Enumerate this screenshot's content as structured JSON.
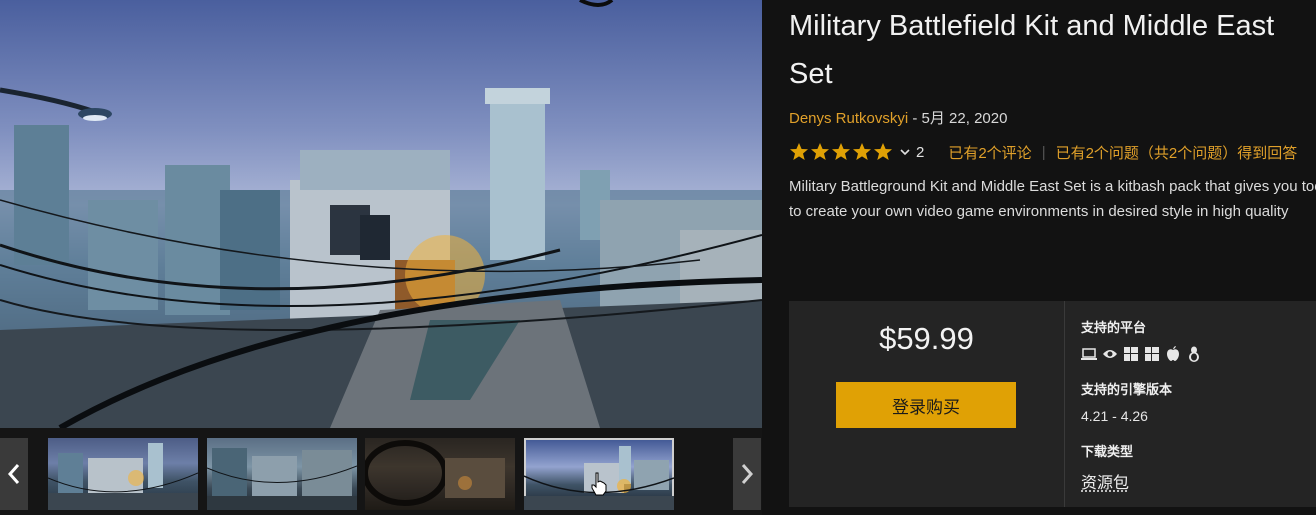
{
  "product": {
    "title": "Military Battlefield Kit and Middle East Set",
    "author": "Denys Rutkovskyi",
    "date_sep": " - ",
    "date": "5月 22, 2020",
    "rating_count": "2",
    "reviews_link": "已有2个评论",
    "questions_link": "已有2个问题（共2个问题）得到回答",
    "description_line1": "Military Battleground Kit and Middle East Set is a kitbash pack that gives you tools",
    "description_line2": "to create your own video game environments in desired style in high quality",
    "stars": 5
  },
  "purchase": {
    "price": "$59.99",
    "buy_label": "登录购买"
  },
  "meta": {
    "platforms_label": "支持的平台",
    "platform_icons": [
      "laptop-icon",
      "eye-icon",
      "windows-icon",
      "windows-icon",
      "apple-icon",
      "linux-icon"
    ],
    "engine_label": "支持的引擎版本",
    "engine_value": "4.21 - 4.26",
    "download_label": "下载类型",
    "download_value": "资源包"
  },
  "gallery": {
    "thumbnail_count": 4,
    "selected_index": 3
  },
  "colors": {
    "accent": "#e0a105",
    "link": "#e0a02a",
    "background": "#121212",
    "panel": "#242424"
  }
}
